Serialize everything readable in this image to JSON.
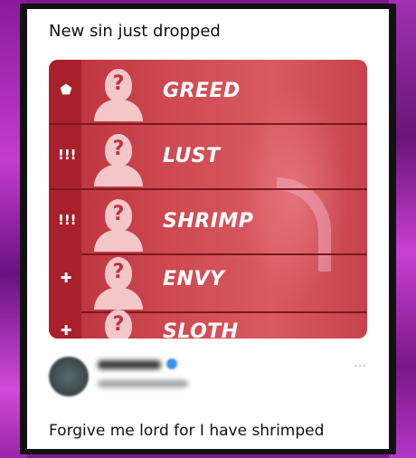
{
  "post": {
    "text": "New sin just dropped"
  },
  "meme": {
    "rows": [
      {
        "badge": "⬟",
        "label": "GREED",
        "question": "?"
      },
      {
        "badge": "!!!",
        "label": "LUST",
        "question": "?"
      },
      {
        "badge": "!!!",
        "label": "SHRIMP",
        "question": "?"
      },
      {
        "badge": "✚",
        "label": "ENVY",
        "question": "?"
      },
      {
        "badge": "✚",
        "label": "SLOTH",
        "question": "?"
      }
    ]
  },
  "reply": {
    "more_label": "..."
  },
  "caption": "Forgive me lord for I have shrimped"
}
